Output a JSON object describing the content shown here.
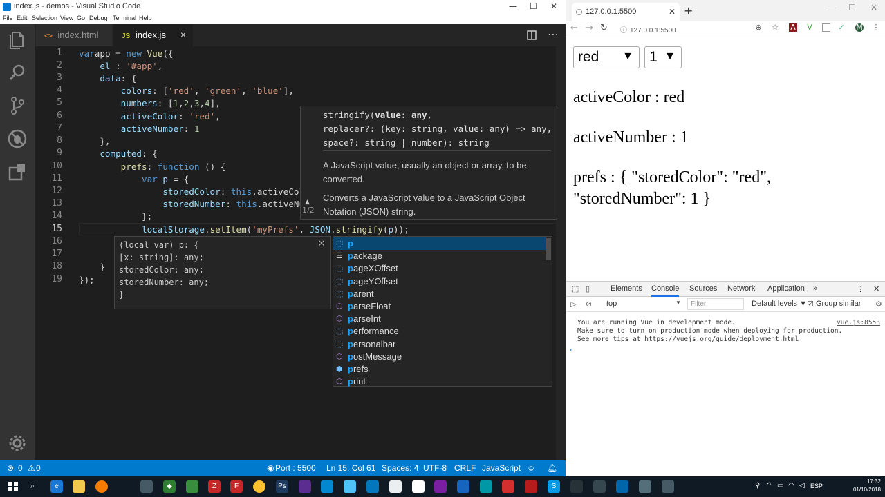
{
  "vscode": {
    "title": "index.js - demos - Visual Studio Code",
    "window_controls": [
      "—",
      "☐",
      "✕"
    ],
    "menu": [
      "File",
      "Edit",
      "Selection",
      "View",
      "Go",
      "Debug",
      "Terminal",
      "Help"
    ],
    "tabs": [
      {
        "label": "index.html",
        "icon": "html-icon"
      },
      {
        "label": "index.js",
        "icon": "JS",
        "close": "×"
      }
    ],
    "line_numbers": [
      "1",
      "2",
      "3",
      "4",
      "5",
      "6",
      "7",
      "8",
      "9",
      "10",
      "11",
      "12",
      "13",
      "14",
      "15",
      "16",
      "17",
      "18",
      "19"
    ],
    "hover": {
      "sig1": "stringify(value: any,",
      "sig2": "replacer?: (key: string, value: any) => any,",
      "sig3": "space?: string | number): string",
      "param_doc": "A JavaScript value, usually an object or array, to be converted.",
      "func_doc": "Converts a JavaScript value to a JavaScript Object Notation (JSON) string.",
      "counter": "1/2"
    },
    "var_hover": {
      "lines": [
        "(local var) p: {",
        "[x: string]: any;",
        "storedColor: any;",
        "storedNumber: any;",
        "}"
      ],
      "close": "×"
    },
    "suggest": {
      "items": [
        {
          "match": "p",
          "rest": "",
          "kind": "var"
        },
        {
          "match": "p",
          "rest": "ackage",
          "kind": "keyword"
        },
        {
          "match": "p",
          "rest": "ageXOffset",
          "kind": "var"
        },
        {
          "match": "p",
          "rest": "ageYOffset",
          "kind": "var"
        },
        {
          "match": "p",
          "rest": "arent",
          "kind": "var"
        },
        {
          "match": "p",
          "rest": "arseFloat",
          "kind": "method"
        },
        {
          "match": "p",
          "rest": "arseInt",
          "kind": "method"
        },
        {
          "match": "p",
          "rest": "erformance",
          "kind": "var"
        },
        {
          "match": "p",
          "rest": "ersonalbar",
          "kind": "var"
        },
        {
          "match": "p",
          "rest": "ostMessage",
          "kind": "method"
        },
        {
          "match": "p",
          "rest": "refs",
          "kind": "property"
        },
        {
          "match": "p",
          "rest": "rint",
          "kind": "method"
        }
      ]
    },
    "status": {
      "errors": "0",
      "warnings": "0",
      "port": "Port : 5500",
      "position": "Ln 15, Col 61",
      "spaces": "Spaces: 4",
      "encoding": "UTF-8",
      "eol": "CRLF",
      "language": "JavaScript"
    }
  },
  "chrome": {
    "tab_title": "127.0.0.1:5500",
    "url": "127.0.0.1:5500",
    "color_select": "red",
    "number_select": "1",
    "active_color_text": "activeColor : red",
    "active_number_text": "activeNumber : 1",
    "prefs_text": "prefs : { \"storedColor\": \"red\", \"storedNumber\": 1 }",
    "profile_initial": "M"
  },
  "devtools": {
    "tabs": [
      "Elements",
      "Console",
      "Sources",
      "Network",
      "Application",
      "»"
    ],
    "context": "top",
    "filter_placeholder": "Filter",
    "levels": "Default levels ▼",
    "group_similar": "Group similar",
    "console_lines": [
      "You are running Vue in development mode.",
      "Make sure to turn on production mode when deploying for production.",
      "See more tips at "
    ],
    "console_link": "https://vuejs.org/guide/deployment.html",
    "console_source": "vue.js:8553"
  },
  "taskbar": {
    "lang": "ESP",
    "time": "17:32",
    "date": "01/10/2018"
  },
  "colors": {
    "vscode_bg": "#1e1e1e",
    "statusbar": "#007acc",
    "suggest_selected": "#094771",
    "match_highlight": "#18a3ff"
  }
}
